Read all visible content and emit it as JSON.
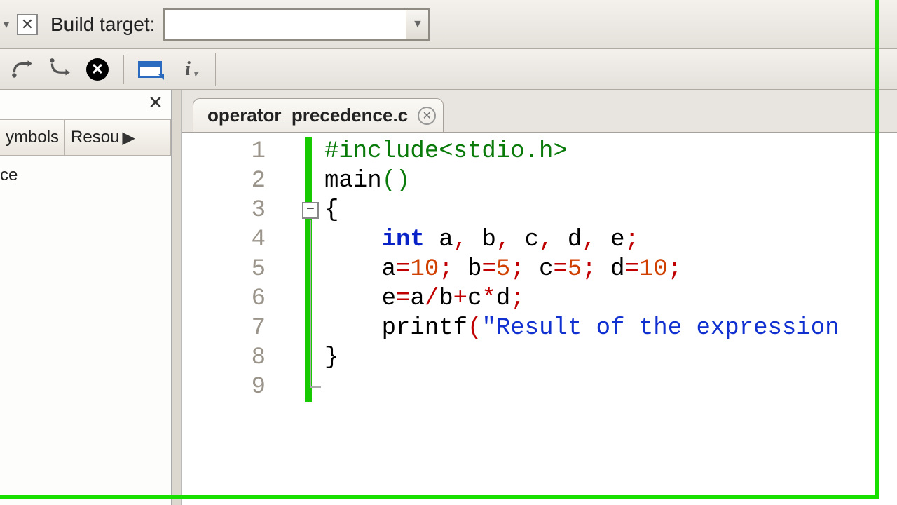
{
  "toolbar": {
    "build_target_label": "Build target:",
    "build_target_value": ""
  },
  "sidebar": {
    "tabs": [
      "ymbols",
      "Resou"
    ],
    "items": [
      "ce"
    ]
  },
  "file_tab": {
    "name": "operator_precedence.c"
  },
  "code": {
    "lines": [
      {
        "n": 1,
        "tokens": [
          {
            "t": "#include<stdio.h>",
            "c": "pp"
          }
        ]
      },
      {
        "n": 2,
        "tokens": [
          {
            "t": "main",
            "c": "fn"
          },
          {
            "t": "()",
            "c": "par"
          }
        ]
      },
      {
        "n": 3,
        "tokens": [
          {
            "t": "{",
            "c": "brace"
          }
        ]
      },
      {
        "n": 4,
        "tokens": [
          {
            "t": "    ",
            "c": "id"
          },
          {
            "t": "int",
            "c": "kw"
          },
          {
            "t": " a",
            "c": "id"
          },
          {
            "t": ",",
            "c": "punc"
          },
          {
            "t": " b",
            "c": "id"
          },
          {
            "t": ",",
            "c": "punc"
          },
          {
            "t": " c",
            "c": "id"
          },
          {
            "t": ",",
            "c": "punc"
          },
          {
            "t": " d",
            "c": "id"
          },
          {
            "t": ",",
            "c": "punc"
          },
          {
            "t": " e",
            "c": "id"
          },
          {
            "t": ";",
            "c": "punc"
          }
        ]
      },
      {
        "n": 5,
        "tokens": [
          {
            "t": "    a",
            "c": "id"
          },
          {
            "t": "=",
            "c": "punc"
          },
          {
            "t": "10",
            "c": "num"
          },
          {
            "t": ";",
            "c": "punc"
          },
          {
            "t": " b",
            "c": "id"
          },
          {
            "t": "=",
            "c": "punc"
          },
          {
            "t": "5",
            "c": "num"
          },
          {
            "t": ";",
            "c": "punc"
          },
          {
            "t": " c",
            "c": "id"
          },
          {
            "t": "=",
            "c": "punc"
          },
          {
            "t": "5",
            "c": "num"
          },
          {
            "t": ";",
            "c": "punc"
          },
          {
            "t": " d",
            "c": "id"
          },
          {
            "t": "=",
            "c": "punc"
          },
          {
            "t": "10",
            "c": "num"
          },
          {
            "t": ";",
            "c": "punc"
          }
        ]
      },
      {
        "n": 6,
        "tokens": [
          {
            "t": "    e",
            "c": "id"
          },
          {
            "t": "=",
            "c": "punc"
          },
          {
            "t": "a",
            "c": "id"
          },
          {
            "t": "/",
            "c": "punc"
          },
          {
            "t": "b",
            "c": "id"
          },
          {
            "t": "+",
            "c": "punc"
          },
          {
            "t": "c",
            "c": "id"
          },
          {
            "t": "*",
            "c": "punc"
          },
          {
            "t": "d",
            "c": "id"
          },
          {
            "t": ";",
            "c": "punc"
          }
        ]
      },
      {
        "n": 7,
        "tokens": [
          {
            "t": "    printf",
            "c": "id"
          },
          {
            "t": "(",
            "c": "punc"
          },
          {
            "t": "\"Result of the expression",
            "c": "str"
          }
        ]
      },
      {
        "n": 8,
        "tokens": [
          {
            "t": "}",
            "c": "brace"
          }
        ]
      },
      {
        "n": 9,
        "tokens": []
      }
    ]
  }
}
